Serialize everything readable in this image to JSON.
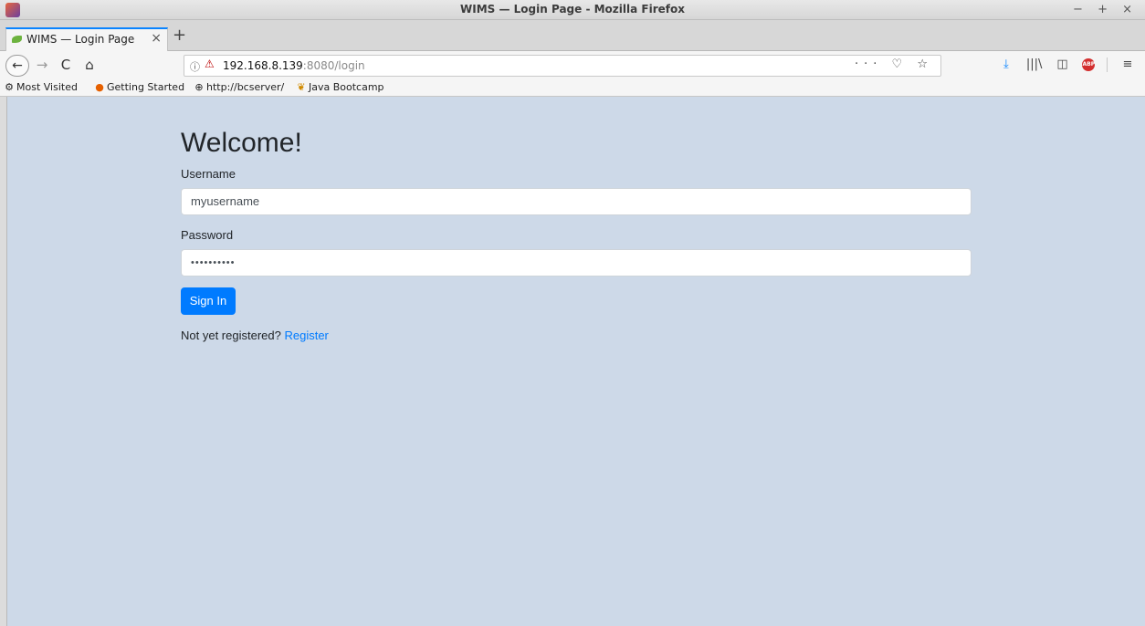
{
  "window": {
    "title": "WIMS — Login Page - Mozilla Firefox",
    "controls": "− + ×"
  },
  "tabs": [
    {
      "title": "WIMS — Login Page",
      "close": "×"
    }
  ],
  "new_tab_label": "+",
  "navbar": {
    "back": "←",
    "forward": "→",
    "reload": "C",
    "home": "⌂",
    "url_host": "192.168.8.139",
    "url_rest": ":8080/login",
    "info_icon": "ⓘ",
    "page_actions": "··· ♡ ☆"
  },
  "toolbar": {
    "download": "⤓",
    "library": "|||\\",
    "sidebar": "◫",
    "abp": "ABP",
    "menu": "≡"
  },
  "bookmarks": [
    {
      "label": "Most Visited",
      "icon": "gear-icon",
      "glyph": "⚙"
    },
    {
      "label": "Getting Started",
      "icon": "firefox-icon",
      "glyph": "●"
    },
    {
      "label": "http://bcserver/",
      "icon": "globe-icon",
      "glyph": "⊕"
    },
    {
      "label": "Java Bootcamp",
      "icon": "bootcamp-icon",
      "glyph": "❦"
    }
  ],
  "page": {
    "heading": "Welcome!",
    "username_label": "Username",
    "username_value": "myusername",
    "password_label": "Password",
    "password_value": "••••••••••",
    "signin_label": "Sign In",
    "register_prompt": "Not yet registered?",
    "register_link": "Register"
  }
}
